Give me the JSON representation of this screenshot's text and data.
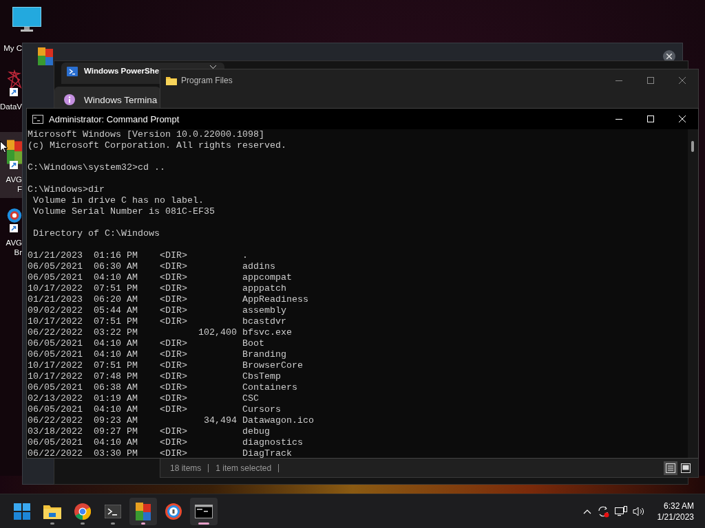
{
  "desktop_icons": [
    {
      "kind": "monitor",
      "label": [
        "My C"
      ],
      "selected": false
    },
    {
      "kind": "datawagon",
      "label": [
        "DataV"
      ],
      "selected": false
    },
    {
      "kind": "avg",
      "label": [
        "AVG",
        "F"
      ],
      "selected": true
    },
    {
      "kind": "avg-browser",
      "label": [
        "AVG",
        "Br"
      ],
      "selected": false
    }
  ],
  "terminal_window": {
    "tabs": [
      {
        "label": "Windows PowerShe",
        "selected": true
      }
    ],
    "menu": [
      {
        "label": "Windows Termina"
      }
    ]
  },
  "explorer_window": {
    "title": "Program Files",
    "status": [
      "18 items",
      "1 item selected"
    ],
    "view_buttons": [
      {
        "kind": "details",
        "selected": true
      },
      {
        "kind": "preview",
        "selected": false
      }
    ]
  },
  "cmd_window": {
    "title": "Administrator:  Command Prompt",
    "blocks": [
      [
        "Microsoft Windows [Version 10.0.22000.1098]",
        "(c) Microsoft Corporation. All rights reserved."
      ],
      [
        "C:\\Windows\\system32>cd .."
      ],
      [
        "C:\\Windows>dir",
        " Volume in drive C has no label.",
        " Volume Serial Number is 081C-EF35"
      ],
      [
        " Directory of C:\\Windows"
      ],
      [
        "01/21/2023  01:16 PM    <DIR>          .",
        "06/05/2021  06:30 AM    <DIR>          addins",
        "06/05/2021  04:10 AM    <DIR>          appcompat",
        "10/17/2022  07:51 PM    <DIR>          apppatch",
        "01/21/2023  06:20 AM    <DIR>          AppReadiness",
        "09/02/2022  05:44 AM    <DIR>          assembly",
        "10/17/2022  07:51 PM    <DIR>          bcastdvr",
        "06/22/2022  03:22 PM           102,400 bfsvc.exe",
        "06/05/2021  04:10 AM    <DIR>          Boot",
        "06/05/2021  04:10 AM    <DIR>          Branding",
        "10/17/2022  07:51 PM    <DIR>          BrowserCore",
        "10/17/2022  07:48 PM    <DIR>          CbsTemp",
        "06/05/2021  06:38 AM    <DIR>          Containers",
        "02/13/2022  01:19 AM    <DIR>          CSC",
        "06/05/2021  04:10 AM    <DIR>          Cursors",
        "06/22/2022  09:23 AM            34,494 Datawagon.ico",
        "03/18/2022  09:27 PM    <DIR>          debug",
        "06/05/2021  04:10 AM    <DIR>          diagnostics",
        "06/22/2022  03:30 PM    <DIR>          DiagTrack"
      ]
    ]
  },
  "taskbar": {
    "apps": [
      {
        "kind": "start",
        "running": false,
        "accent": false,
        "focused": false,
        "selected": false
      },
      {
        "kind": "explorer",
        "running": true,
        "accent": false,
        "focused": false,
        "selected": false
      },
      {
        "kind": "chrome",
        "running": true,
        "accent": false,
        "focused": false,
        "selected": false
      },
      {
        "kind": "terminal",
        "running": true,
        "accent": false,
        "focused": false,
        "selected": false
      },
      {
        "kind": "avg",
        "running": true,
        "accent": true,
        "focused": false,
        "selected": true
      },
      {
        "kind": "avg-browser",
        "running": false,
        "accent": false,
        "focused": false,
        "selected": false
      },
      {
        "kind": "cmd",
        "running": true,
        "accent": true,
        "focused": true,
        "selected": true
      }
    ],
    "clock": {
      "time": "6:32 AM",
      "date": "1/21/2023"
    }
  }
}
